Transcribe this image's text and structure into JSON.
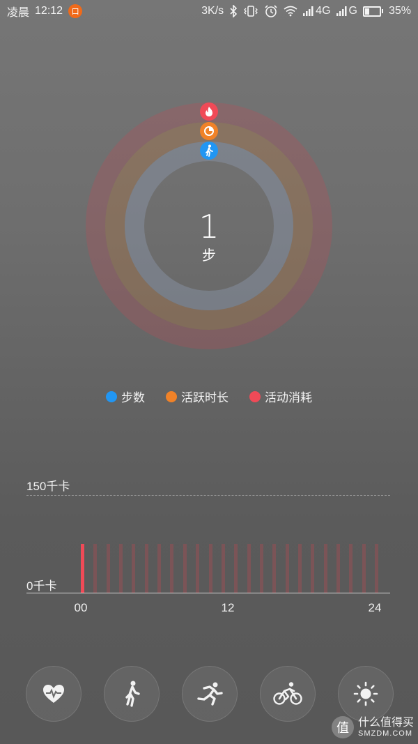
{
  "status_bar": {
    "period": "凌晨",
    "time": "12:12",
    "notification_glyph": "口",
    "net_speed": "3K/s",
    "signal1_label": "4G",
    "signal2_label": "G",
    "battery_pct": "35%",
    "battery_level": 0.35,
    "icons": [
      "bluetooth-icon",
      "vibrate-icon",
      "alarm-icon",
      "wifi-icon",
      "signal-icon",
      "battery-icon"
    ]
  },
  "summary": {
    "steps_value": "1",
    "steps_unit": "步",
    "rings": [
      {
        "name": "calories",
        "icon": "flame-icon",
        "color": "#f04a57"
      },
      {
        "name": "active-time",
        "icon": "clock-icon",
        "color": "#f08228"
      },
      {
        "name": "steps",
        "icon": "walk-icon",
        "color": "#2196f3"
      }
    ]
  },
  "legend": [
    {
      "label": "步数",
      "color": "#2196f3"
    },
    {
      "label": "活跃时长",
      "color": "#f08228"
    },
    {
      "label": "活动消耗",
      "color": "#f04a57"
    }
  ],
  "chart_data": {
    "type": "bar",
    "y_ticks": [
      "150千卡",
      "0千卡"
    ],
    "x_ticks": [
      "00",
      "12",
      "24"
    ],
    "ylim": [
      0,
      150
    ],
    "values": [
      1,
      0,
      0,
      0,
      0,
      0,
      0,
      0,
      0,
      0,
      0,
      0,
      0,
      0,
      0,
      0,
      0,
      0,
      0,
      0,
      0,
      0,
      0,
      0
    ],
    "highlight_index": 0,
    "colors": {
      "active": "#f04a57",
      "inactive": "rgba(192,70,80,0.32)"
    },
    "grid": true
  },
  "actions": [
    {
      "icon": "heart-rate-icon"
    },
    {
      "icon": "walk-icon"
    },
    {
      "icon": "run-icon"
    },
    {
      "icon": "bike-icon"
    },
    {
      "icon": "sun-icon"
    }
  ],
  "watermark": {
    "logo_glyph": "值",
    "line1": "什么值得买",
    "line2": "SMZDM.COM"
  }
}
